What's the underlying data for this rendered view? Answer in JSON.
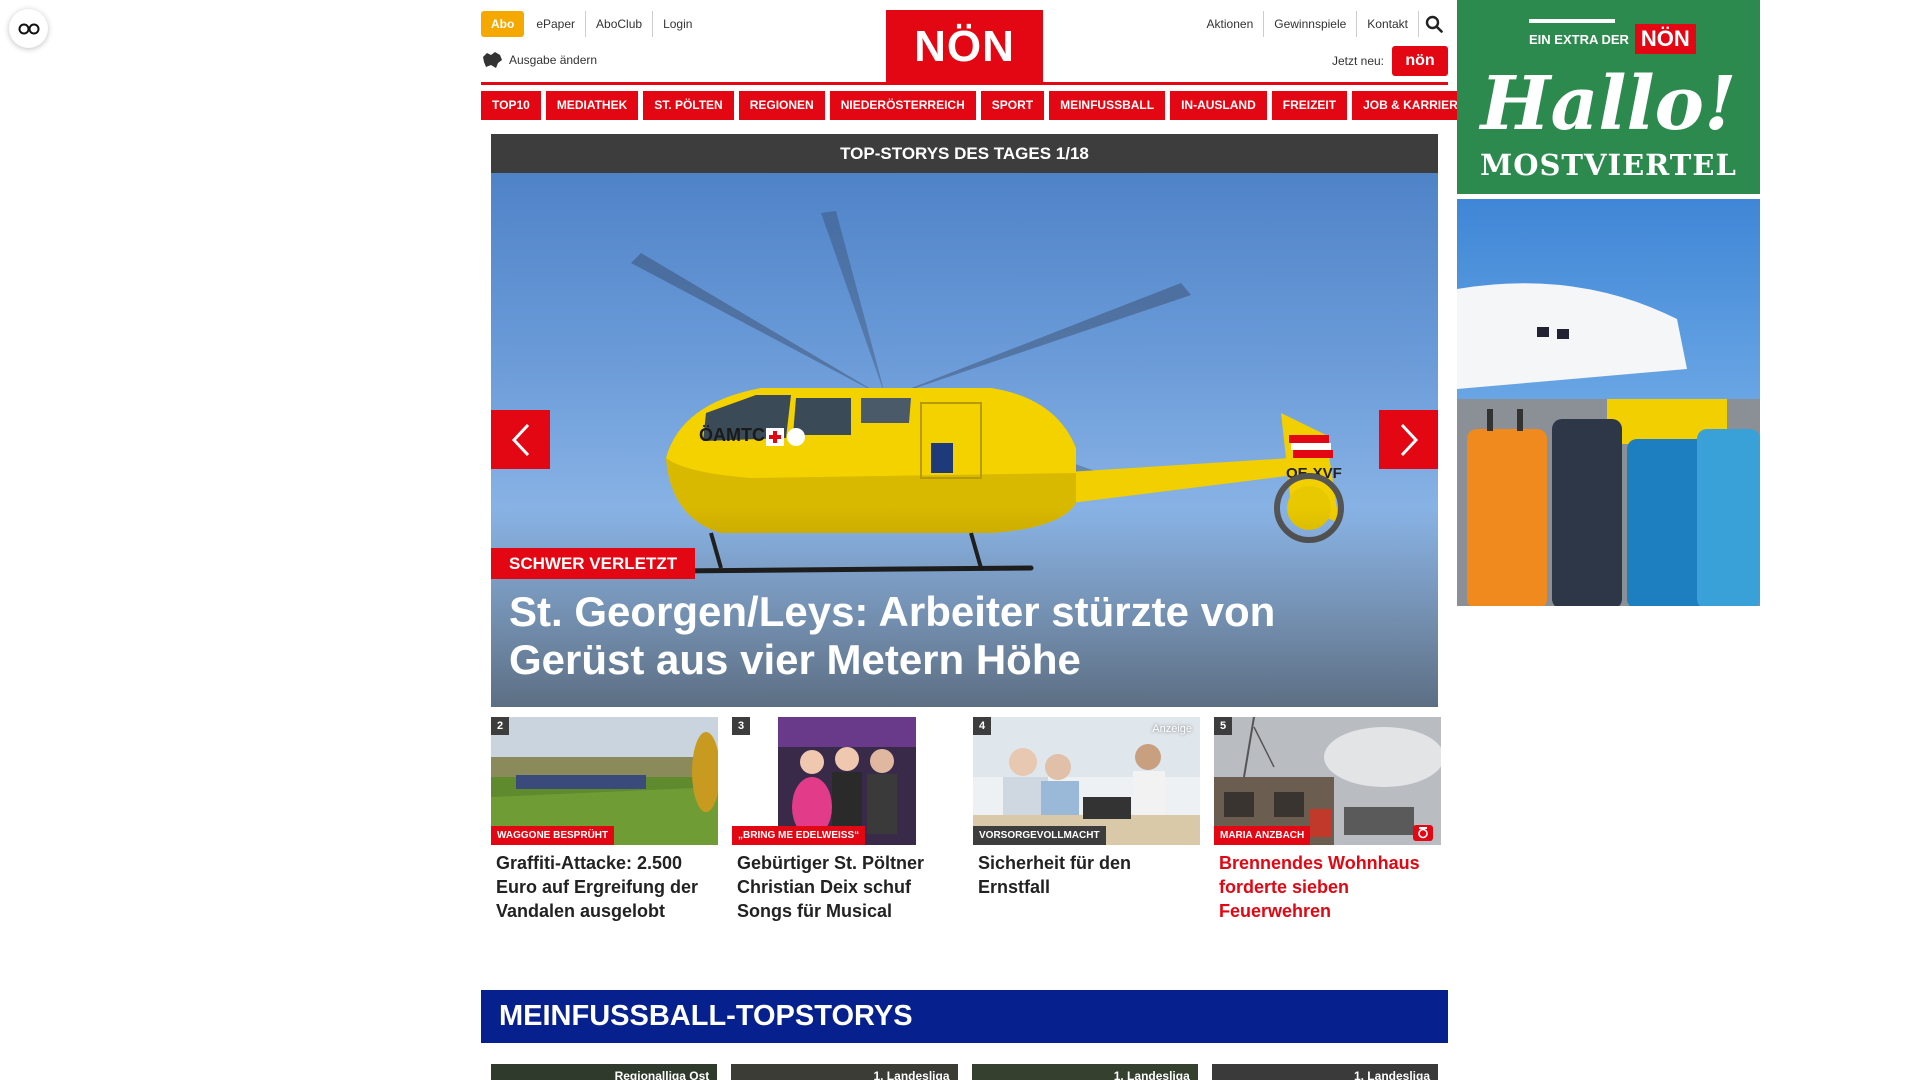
{
  "header": {
    "abo": "Abo",
    "left_links": [
      "ePaper",
      "AboClub",
      "Login"
    ],
    "edition": "Ausgabe ändern",
    "logo": "NÖN",
    "right_links": [
      "Aktionen",
      "Gewinnspiele",
      "Kontakt"
    ],
    "jetzt_neu": "Jetzt neu:",
    "jetzt_badge": "nön"
  },
  "nav": [
    "TOP10",
    "MEDIATHEK",
    "ST. PÖLTEN",
    "REGIONEN",
    "NIEDERÖSTERREICH",
    "SPORT",
    "MEINFUSSBALL",
    "IN-AUSLAND",
    "FREIZEIT",
    "JOB & KARRIERE"
  ],
  "hero": {
    "heading": "TOP-STORYS DES TAGES 1/18",
    "kicker": "SCHWER VERLETZT",
    "title": "St. Georgen/Leys: Arbeiter stürzte von Gerüst aus vier Metern Höhe",
    "heli_text": "ÖAMTC",
    "heli_reg": "OE-XVF"
  },
  "teasers": [
    {
      "num": "2",
      "kicker": "WAGGONE BESPRÜHT",
      "title": "Graffiti-Attacke: 2.500 Euro auf Ergreifung der Vandalen ausgelobt"
    },
    {
      "num": "3",
      "kicker": "„BRING ME EDELWEISS“",
      "title": "Gebürtiger St. Pöltner Christian Deix schuf Songs für Musical"
    },
    {
      "num": "4",
      "kicker": "VORSORGEVOLLMACHT",
      "badge": "Anzeige",
      "title": "Sicherheit für den Ernstfall"
    },
    {
      "num": "5",
      "kicker": "MARIA ANZBACH",
      "title": "Brennendes Wohnhaus forderte sieben Feuerwehren"
    }
  ],
  "section": {
    "title": "MEINFUSSBALL-TOPSTORYS",
    "cards": [
      "Regionalliga Ost",
      "1. Landesliga",
      "1. Landesliga",
      "1. Landesliga"
    ]
  },
  "ad": {
    "extra": "EIN EXTRA DER",
    "logo": "NÖN",
    "hallo": "Hallo!",
    "region": "MOSTVIERTEL"
  },
  "colors": {
    "brand_red": "#e30613",
    "abo_orange": "#f5a800",
    "section_blue": "#06218e",
    "ad_green": "#2d8a4e"
  }
}
